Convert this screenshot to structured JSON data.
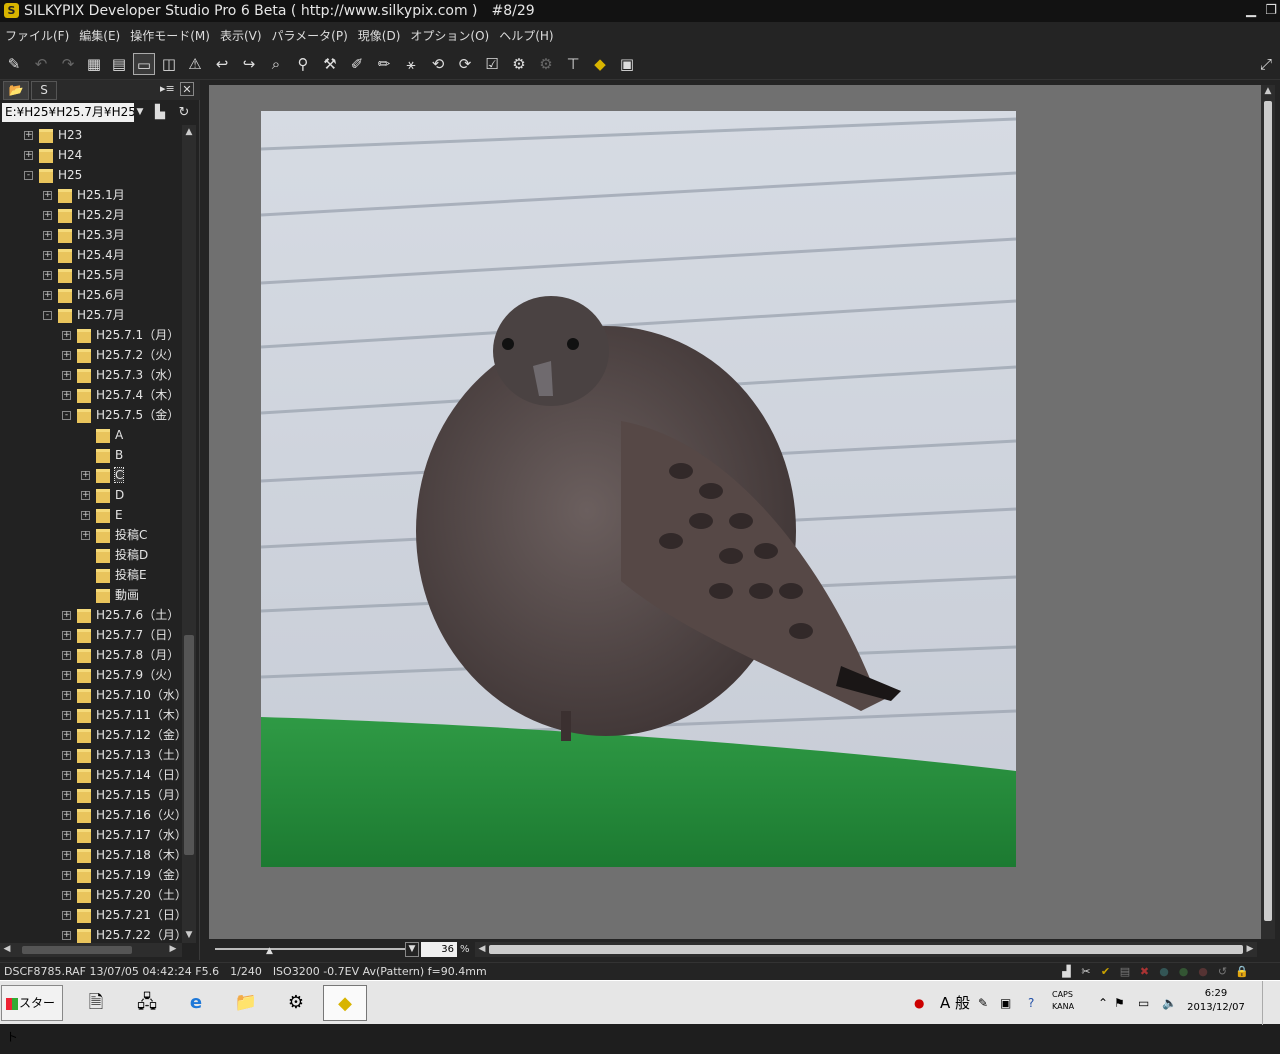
{
  "window": {
    "title": "SILKYPIX Developer Studio Pro 6 Beta ( http://www.silkypix.com )　#8/29",
    "minimize_icon": "minimize-icon",
    "restore_icon": "restore-icon"
  },
  "menu": [
    "ファイル(F)",
    "編集(E)",
    "操作モード(M)",
    "表示(V)",
    "パラメータ(P)",
    "現像(D)",
    "オプション(O)",
    "ヘルプ(H)"
  ],
  "toolbar": {
    "icons": [
      "eraser-icon",
      "undo-icon",
      "redo-icon",
      "grid-view-icon",
      "filmstrip-view-icon",
      "single-view-icon",
      "compare-view-icon",
      "warning-icon",
      "prev-image-icon",
      "next-image-icon",
      "zoom-icon",
      "dropper-icon",
      "pipette-icon",
      "brush-icon",
      "pen-icon",
      "wand-icon",
      "rotate-left-icon",
      "rotate-right-icon",
      "check-icon",
      "develop-icon",
      "batch-develop-icon",
      "hammer-icon",
      "silkypix-logo-icon",
      "monitor-icon"
    ],
    "fullscreen_icon": "fullscreen-icon"
  },
  "left_panel": {
    "path": "E:¥H25¥H25.7月¥H25",
    "tree": [
      {
        "label": "H23",
        "level": 1,
        "expand": "+"
      },
      {
        "label": "H24",
        "level": 1,
        "expand": "+"
      },
      {
        "label": "H25",
        "level": 1,
        "expand": "-"
      },
      {
        "label": "H25.1月",
        "level": 2,
        "expand": "+"
      },
      {
        "label": "H25.2月",
        "level": 2,
        "expand": "+"
      },
      {
        "label": "H25.3月",
        "level": 2,
        "expand": "+"
      },
      {
        "label": "H25.4月",
        "level": 2,
        "expand": "+"
      },
      {
        "label": "H25.5月",
        "level": 2,
        "expand": "+"
      },
      {
        "label": "H25.6月",
        "level": 2,
        "expand": "+"
      },
      {
        "label": "H25.7月",
        "level": 2,
        "expand": "-"
      },
      {
        "label": "H25.7.1（月）",
        "level": 3,
        "expand": "+"
      },
      {
        "label": "H25.7.2（火）",
        "level": 3,
        "expand": "+"
      },
      {
        "label": "H25.7.3（水）",
        "level": 3,
        "expand": "+"
      },
      {
        "label": "H25.7.4（木）",
        "level": 3,
        "expand": "+"
      },
      {
        "label": "H25.7.5（金）",
        "level": 3,
        "expand": "-"
      },
      {
        "label": "A",
        "level": 4,
        "expand": ""
      },
      {
        "label": "B",
        "level": 4,
        "expand": ""
      },
      {
        "label": "C",
        "level": 4,
        "expand": "+",
        "selected": true
      },
      {
        "label": "D",
        "level": 4,
        "expand": "+"
      },
      {
        "label": "E",
        "level": 4,
        "expand": "+"
      },
      {
        "label": "投稿C",
        "level": 4,
        "expand": "+"
      },
      {
        "label": "投稿D",
        "level": 4,
        "expand": ""
      },
      {
        "label": "投稿E",
        "level": 4,
        "expand": ""
      },
      {
        "label": "動画",
        "level": 4,
        "expand": ""
      },
      {
        "label": "H25.7.6（土）",
        "level": 3,
        "expand": "+"
      },
      {
        "label": "H25.7.7（日）",
        "level": 3,
        "expand": "+"
      },
      {
        "label": "H25.7.8（月）",
        "level": 3,
        "expand": "+"
      },
      {
        "label": "H25.7.9（火）",
        "level": 3,
        "expand": "+"
      },
      {
        "label": "H25.7.10（水）",
        "level": 3,
        "expand": "+"
      },
      {
        "label": "H25.7.11（木）",
        "level": 3,
        "expand": "+"
      },
      {
        "label": "H25.7.12（金）",
        "level": 3,
        "expand": "+"
      },
      {
        "label": "H25.7.13（土）",
        "level": 3,
        "expand": "+"
      },
      {
        "label": "H25.7.14（日）",
        "level": 3,
        "expand": "+"
      },
      {
        "label": "H25.7.15（月）",
        "level": 3,
        "expand": "+"
      },
      {
        "label": "H25.7.16（火）",
        "level": 3,
        "expand": "+"
      },
      {
        "label": "H25.7.17（水）",
        "level": 3,
        "expand": "+"
      },
      {
        "label": "H25.7.18（木）",
        "level": 3,
        "expand": "+"
      },
      {
        "label": "H25.7.19（金）",
        "level": 3,
        "expand": "+"
      },
      {
        "label": "H25.7.20（土）",
        "level": 3,
        "expand": "+"
      },
      {
        "label": "H25.7.21（日）",
        "level": 3,
        "expand": "+"
      },
      {
        "label": "H25.7.22（月）",
        "level": 3,
        "expand": "+"
      }
    ]
  },
  "viewer": {
    "zoom_value": "36",
    "zoom_unit": "%"
  },
  "status": {
    "text": "DSCF8785.RAF 13/07/05 04:42:24 F5.6　1/240　ISO3200 -0.7EV Av(Pattern) f=90.4mm"
  },
  "taskbar": {
    "start_label": "スタート",
    "ime_mode": "A 般",
    "caps": "CAPS",
    "kana": "KANA",
    "time": "6:29",
    "date": "2013/12/07"
  }
}
